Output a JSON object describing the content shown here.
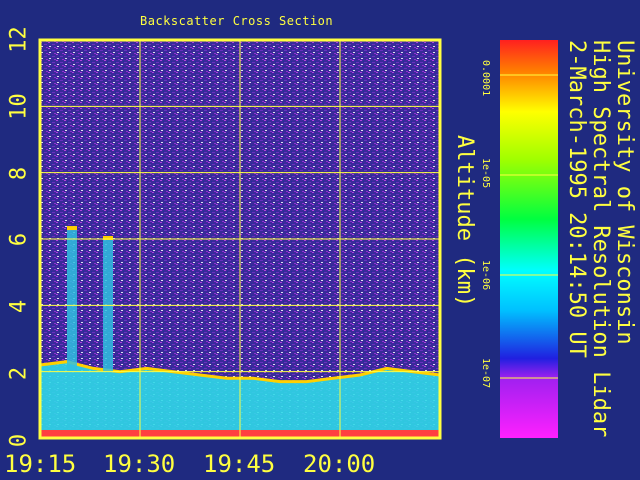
{
  "chart_data": {
    "type": "heatmap",
    "title": "Backscatter Cross Section",
    "ylabel": "Altitude (km)",
    "ylim": [
      0,
      12
    ],
    "yticks": [
      "0",
      "2",
      "4",
      "6",
      "8",
      "10",
      "12"
    ],
    "xticks": [
      "19:15",
      "19:30",
      "19:45",
      "20:00"
    ],
    "colorbar": {
      "ticks": [
        "0.0001",
        "1e-05",
        "1e-06",
        "1e-07"
      ],
      "scale": "log"
    },
    "grid": true,
    "boundary_layer_top_km": [
      2.2,
      2.3,
      2.1,
      2.0,
      2.1,
      2.0,
      1.9,
      1.8,
      1.8,
      1.7,
      1.7,
      1.8,
      1.9,
      2.1,
      2.0,
      1.9
    ],
    "cloud_plumes": [
      {
        "x_frac": 0.08,
        "top_km": 6.3
      },
      {
        "x_frac": 0.17,
        "top_km": 6.0
      }
    ]
  },
  "side_text": {
    "line1": "University of Wisconsin",
    "line2": "High Spectral Resolution Lidar",
    "line3": "2-March-1995 20:14:50 UT"
  },
  "colors": {
    "background": "#1f2a80",
    "frame": "#ffff40",
    "noise": "#7a2fd0",
    "boundary_layer": "#30d8e8",
    "surface": "#ff4040"
  }
}
